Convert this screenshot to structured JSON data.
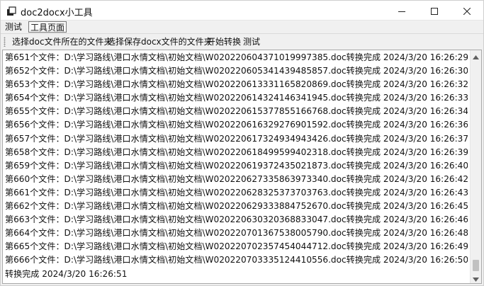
{
  "window": {
    "title": "doc2docx小工具"
  },
  "menubar": {
    "items": [
      {
        "label": "测试"
      },
      {
        "label": "工具页面"
      }
    ]
  },
  "toolbar": {
    "items": [
      {
        "label": "选择doc文件所在的文件夹"
      },
      {
        "label": "选择保存docx文件的文件夹"
      },
      {
        "label": "开始转换"
      },
      {
        "label": "测试"
      }
    ]
  },
  "log": {
    "lines": [
      "第651个文件：D:\\学习路线\\港口水情文档\\初始文档\\W020220604371019997385.doc转换完成 2024/3/20 16:26:29",
      "第652个文件：D:\\学习路线\\港口水情文档\\初始文档\\W020220605341439485857.doc转换完成 2024/3/20 16:26:30",
      "第653个文件：D:\\学习路线\\港口水情文档\\初始文档\\W020220613331165820869.doc转换完成 2024/3/20 16:26:32",
      "第654个文件：D:\\学习路线\\港口水情文档\\初始文档\\W020220614324146341945.doc转换完成 2024/3/20 16:26:33",
      "第655个文件：D:\\学习路线\\港口水情文档\\初始文档\\W020220615377855166768.doc转换完成 2024/3/20 16:26:34",
      "第656个文件：D:\\学习路线\\港口水情文档\\初始文档\\W020220616329276901592.doc转换完成 2024/3/20 16:26:36",
      "第657个文件：D:\\学习路线\\港口水情文档\\初始文档\\W020220617324934943426.doc转换完成 2024/3/20 16:26:37",
      "第658个文件：D:\\学习路线\\港口水情文档\\初始文档\\W020220618499599402318.doc转换完成 2024/3/20 16:26:39",
      "第659个文件：D:\\学习路线\\港口水情文档\\初始文档\\W020220619372435021873.doc转换完成 2024/3/20 16:26:40",
      "第660个文件：D:\\学习路线\\港口水情文档\\初始文档\\W020220627335863973340.doc转换完成 2024/3/20 16:26:42",
      "第661个文件：D:\\学习路线\\港口水情文档\\初始文档\\W020220628325373703763.doc转换完成 2024/3/20 16:26:43",
      "第662个文件：D:\\学习路线\\港口水情文档\\初始文档\\W020220629333884752670.doc转换完成 2024/3/20 16:26:45",
      "第663个文件：D:\\学习路线\\港口水情文档\\初始文档\\W020220630320368833047.doc转换完成 2024/3/20 16:26:46",
      "第664个文件：D:\\学习路线\\港口水情文档\\初始文档\\W020220701367538005790.doc转换完成 2024/3/20 16:26:48",
      "第665个文件：D:\\学习路线\\港口水情文档\\初始文档\\W020220702357454044712.doc转换完成 2024/3/20 16:26:49",
      "第666个文件：D:\\学习路线\\港口水情文档\\初始文档\\W020220703335124410556.doc转换完成 2024/3/20 16:26:50",
      "转换完成 2024/3/20 16:26:51"
    ],
    "scroll_position": 0.97
  }
}
